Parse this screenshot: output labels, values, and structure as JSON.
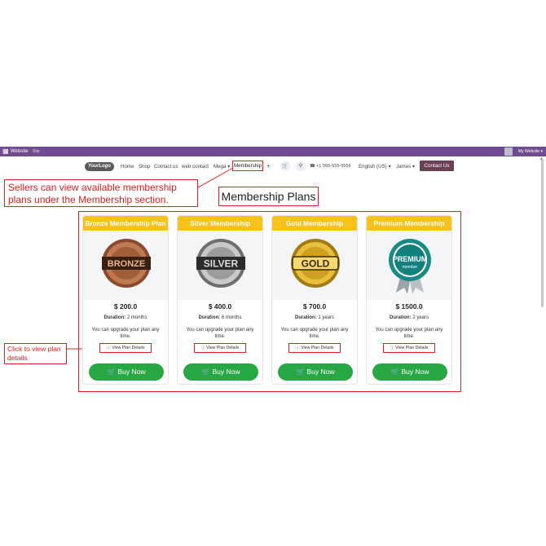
{
  "topbar": {
    "app": "Website",
    "site": "Site",
    "right": "My Website ▾"
  },
  "navbar": {
    "logo": "YourLogo",
    "items": [
      "Home",
      "Shop",
      "Contact us",
      "web contact",
      "Mega ▾"
    ],
    "membership": "Membership",
    "phone": "+1 555-555-5556",
    "language": "English (US) ▾",
    "user": "James ▾",
    "contact_button": "Contact Us"
  },
  "callouts": {
    "top": "Sellers can view available membership plans under the Membership section.",
    "side": "Click to view plan details."
  },
  "page_title": "Membership Plans",
  "plans": [
    {
      "title": "Bronze Membership Plan",
      "badge": "BRONZE",
      "price": "$ 200.0",
      "duration_label": "Duration:",
      "duration": "2 months",
      "upgrade": "You can upgrade your plan any time.",
      "details": "View Plan Details",
      "buy": "Buy Now"
    },
    {
      "title": "Silver Membership",
      "badge": "SILVER",
      "price": "$ 400.0",
      "duration_label": "Duration:",
      "duration": "6 months",
      "upgrade": "You can upgrade your plan any time.",
      "details": "View Plan Details",
      "buy": "Buy Now"
    },
    {
      "title": "Gold Membership",
      "badge": "GOLD",
      "price": "$ 700.0",
      "duration_label": "Duration:",
      "duration": "1 years",
      "upgrade": "You can upgrade your plan any time.",
      "details": "View Plan Details",
      "buy": "Buy Now"
    },
    {
      "title": "Premium Membership",
      "badge": "PREMIUM",
      "badge_sub": "member",
      "price": "$ 1500.0",
      "duration_label": "Duration:",
      "duration": "2 years",
      "upgrade": "You can upgrade your plan any time.",
      "details": "View Plan Details",
      "buy": "Buy Now"
    }
  ],
  "badge_ring_text": "MEMBERSHIP",
  "colors": {
    "topbar": "#714b8f",
    "card_header": "#f8c21c",
    "buy_button": "#28a745",
    "annotation": "#e02020",
    "contact_button": "#6d3f57"
  }
}
